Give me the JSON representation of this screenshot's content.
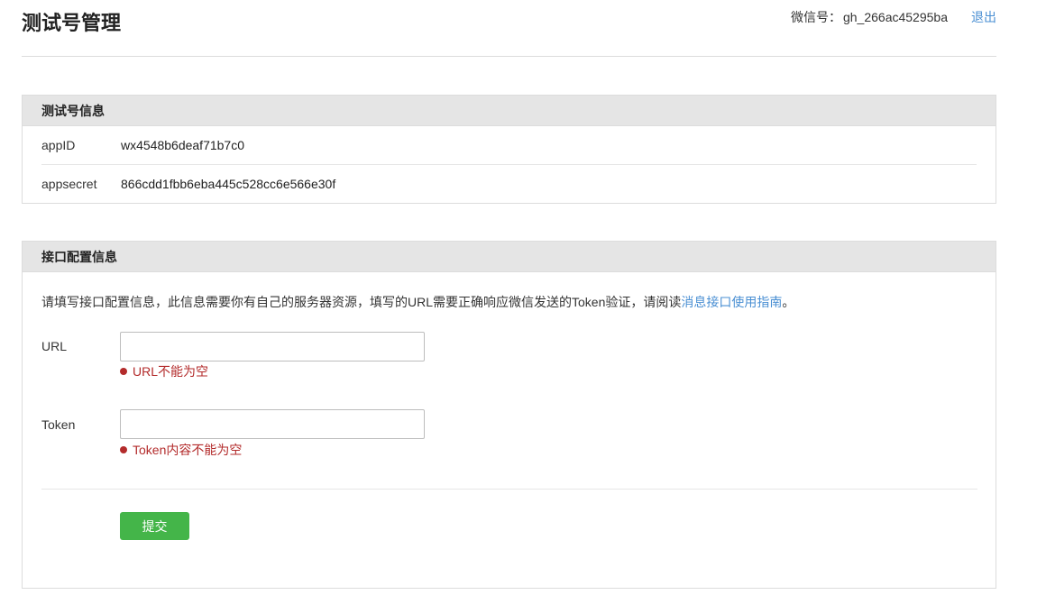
{
  "header": {
    "title": "测试号管理",
    "account_label": "微信号：",
    "account_id": "gh_266ac45295ba",
    "logout_label": "退出"
  },
  "test_info": {
    "title": "测试号信息",
    "rows": [
      {
        "key": "appID",
        "value": "wx4548b6deaf71b7c0"
      },
      {
        "key": "appsecret",
        "value": "866cdd1fbb6eba445c528cc6e566e30f"
      }
    ]
  },
  "config": {
    "title": "接口配置信息",
    "description": "请填写接口配置信息，此信息需要你有自己的服务器资源，填写的URL需要正确响应微信发送的Token验证，请阅读",
    "guide_link": "消息接口使用指南",
    "description_end": "。",
    "url": {
      "label": "URL",
      "value": "",
      "error": "URL不能为空"
    },
    "token": {
      "label": "Token",
      "value": "",
      "error": "Token内容不能为空"
    },
    "submit_label": "提交"
  },
  "colors": {
    "link": "#4a8fd3",
    "error": "#b32b2b",
    "submit": "#44b549"
  }
}
